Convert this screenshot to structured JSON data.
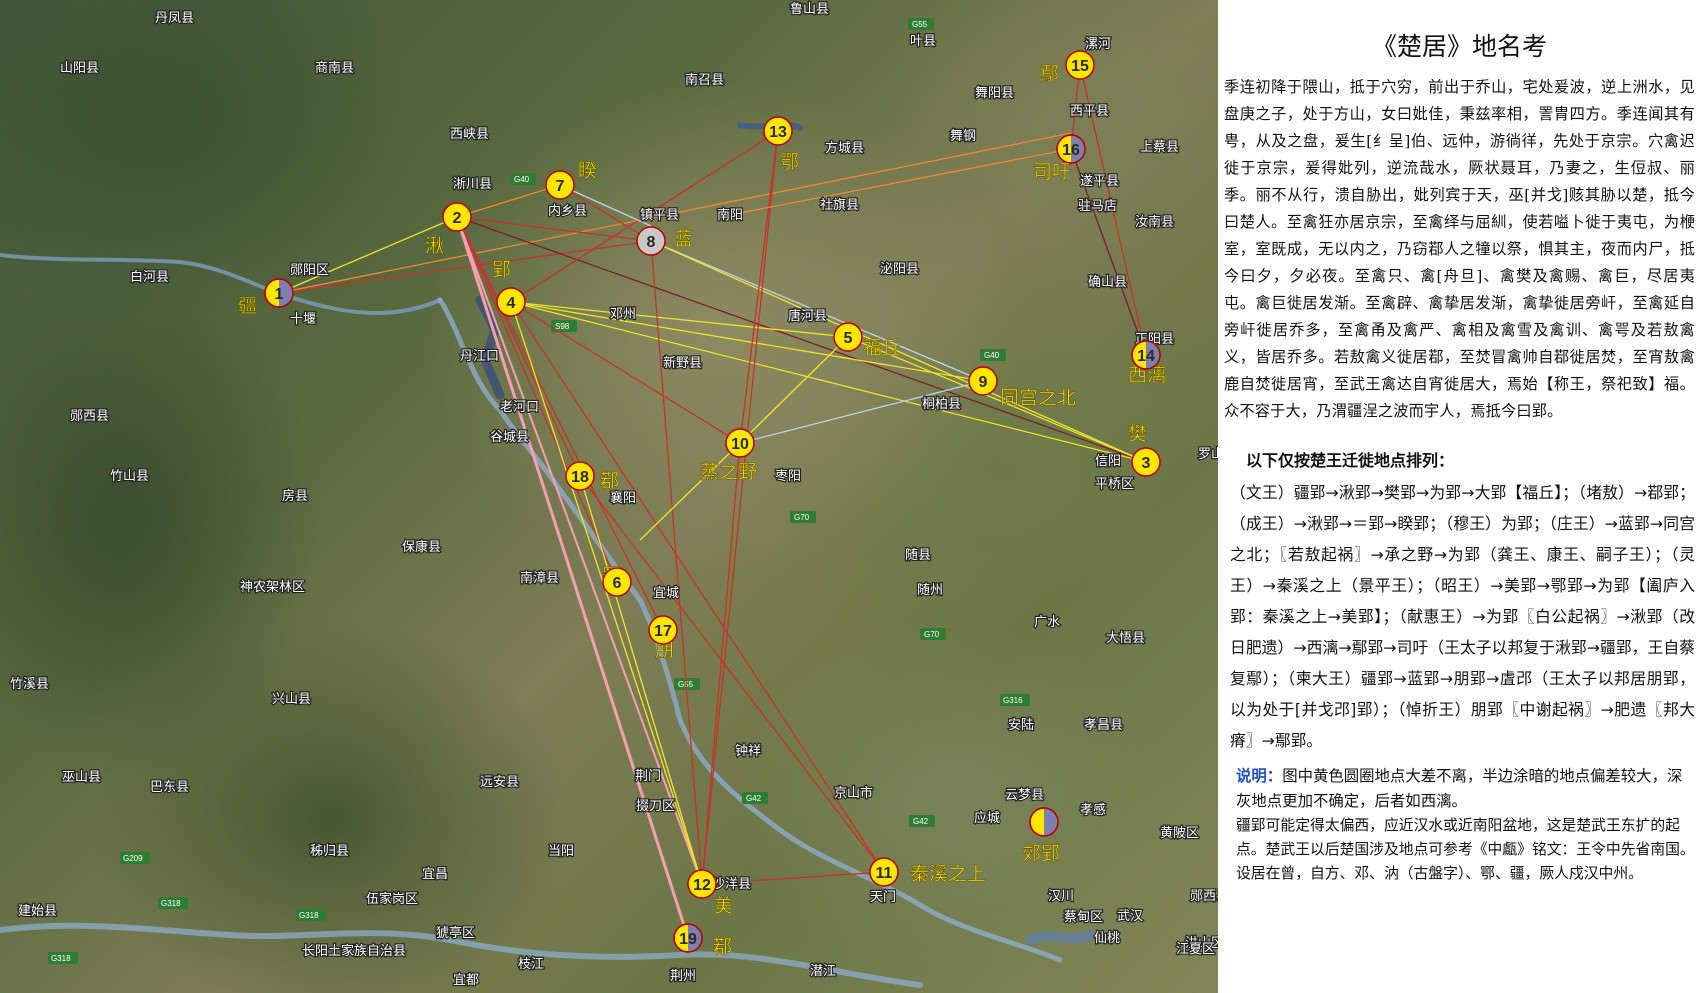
{
  "colors": {
    "marker_fill": "#ffe600",
    "marker_stroke": "#b80000",
    "site_label": "#ffe800",
    "half_dark": "#7d7fae",
    "line_red": "#c8322a",
    "line_yellow": "#f0e52a",
    "line_pink": "#f4a0b0",
    "line_orange": "#f08a30",
    "line_lightblue": "#b9d6ea",
    "line_darkred": "#7a1f2a"
  },
  "map": {
    "markers": [
      {
        "n": "1",
        "state": "half"
      },
      {
        "n": "2",
        "state": "full"
      },
      {
        "n": "3",
        "state": "full"
      },
      {
        "n": "4",
        "state": "full"
      },
      {
        "n": "5",
        "state": "full"
      },
      {
        "n": "6",
        "state": "full"
      },
      {
        "n": "7",
        "state": "full"
      },
      {
        "n": "8",
        "state": "gray"
      },
      {
        "n": "9",
        "state": "full"
      },
      {
        "n": "10",
        "state": "full"
      },
      {
        "n": "11",
        "state": "full"
      },
      {
        "n": "12",
        "state": "full"
      },
      {
        "n": "13",
        "state": "full"
      },
      {
        "n": "14",
        "state": "half"
      },
      {
        "n": "15",
        "state": "full"
      },
      {
        "n": "16",
        "state": "half"
      },
      {
        "n": "17",
        "state": "full"
      },
      {
        "n": "18",
        "state": "full"
      },
      {
        "n": "19",
        "state": "half"
      },
      {
        "n": "",
        "state": "half"
      }
    ],
    "site_labels": [
      "疆",
      "湫",
      "郢",
      "樊",
      "福丘",
      "同宫之北",
      "蒸之野",
      "鄀",
      "郢",
      "朋",
      "美",
      "鄀",
      "秦溪之上",
      "鄢",
      "司吁",
      "西漓",
      "睽",
      "蓝",
      "鄂",
      "郊郢"
    ],
    "cities": [
      "丹凤县",
      "商南县",
      "山阳县",
      "西峡县",
      "淅川县",
      "内乡县",
      "镇平县",
      "南阳",
      "南召县",
      "方城县",
      "舞钢",
      "舞阳县",
      "漯河",
      "叶县",
      "鲁山县",
      "西平县",
      "上蔡县",
      "遂平县",
      "驻马店",
      "汝南县",
      "确山县",
      "正阳县",
      "泌阳县",
      "唐河县",
      "社旗县",
      "新野县",
      "桐柏县",
      "信阳",
      "平桥区",
      "罗山",
      "邓州",
      "丹江口",
      "老河口",
      "谷城县",
      "襄阳",
      "枣阳",
      "南漳县",
      "宜城",
      "随县",
      "随州",
      "广水",
      "大悟县",
      "安陆",
      "孝昌县",
      "孝感",
      "云梦县",
      "应城",
      "汉川",
      "京山市",
      "钟祥",
      "荆门",
      "掇刀区",
      "沙洋县",
      "天门",
      "潜江",
      "荆州",
      "枝江",
      "宜都",
      "当阳",
      "远安县",
      "保康县",
      "房县",
      "竹山县",
      "竹溪县",
      "郧西县",
      "白河县",
      "郧阳区",
      "十堰",
      "神农架林区",
      "兴山县",
      "巴东县",
      "巫山县",
      "秭归县",
      "宜昌",
      "建始县",
      "伍家岗区",
      "长阳土家族自治县",
      "猇亭区",
      "蔡甸区",
      "武汉",
      "黄陂区",
      "洪山区",
      "江夏区",
      "仙桃",
      "郧西县"
    ]
  },
  "panel": {
    "title": "《楚居》地名考",
    "body": "季连初降于隈山，抵于穴穷，前出于乔山，宅处爰波，逆上洲水，见盘庚之子，处于方山，女曰妣佳，秉兹率相，詈胄四方。季连闻其有甹，从及之盘，爰生[纟呈]伯、远仲，游徜徉，先处于京宗。穴禽迟徙于京宗，爰得妣列，逆流哉水，厥状聂耳，乃妻之，生侸叔、丽季。丽不从行，溃自胁出，妣列宾于天，巫[并戈]赅其胁以楚，抵今曰楚人。至禽狂亦居京宗，至禽绎与屈紃，使若嗌卜徙于夷屯，为楩室，室既成，无以内之，乃窃鄀人之犝以祭，惧其主，夜而内尸，抵今曰夕，夕必夜。至禽只、禽[舟旦]、禽樊及禽赐、禽巨，尽居夷屯。禽巨徙居发渐。至禽辟、禽挚居发渐，禽挚徙居旁屽，至禽延自旁屽徙居乔多，至禽甬及禽严、禽相及禽雪及禽训、禽咢及若敖禽义，皆居乔多。若敖禽义徙居鄀，至焚冒禽帅自鄀徙居焚，至宵敖禽鹿自焚徙居宵，至武王禽达自宵徙居大，焉始【称王，祭祀致】福。众不容于大，乃渭疆浧之波而宇人，焉抵今曰郢。",
    "subhead": "以下仅按楚王迁徙地点排列：",
    "sequence": "（文王）疆郢→湫郢→樊郢→为郢→大郢【福丘】；（堵敖）→鄀郢；（成王）→湫郢→＝郢→睽郢；（穆王）为郢；（庄王）→蓝郢→同宫之北；〖若敖起祸〗→承之野→为郢（龚王、康王、嗣子王）；（灵王）→秦溪之上（景平王）；（昭王）→美郢→鄂郢→为郢【阖庐入郢：秦溪之上→美郢】；（献惠王）→为郢〖白公起祸〗→湫郢（改日肥遗）→西漓→鄢郢→司吁（王太子以邦复于湫郢→疆郢，王自蔡复鄢）；（柬大王）疆郢→蓝郢→朋郢→虘邔（王太子以邦居朋郢，以为处于[并戈邔]郢）；（悼折王）朋郢〖中谢起祸〗→肥遗〖邦大瘠〗→鄢郢。",
    "note_label": "说明：",
    "note": "图中黄色圆圈地点大差不离，半边涂暗的地点偏差较大，深灰地点更加不确定，后者如西漓。",
    "note2": "疆郢可能定得太偏西，应近汉水或近南阳盆地，这是楚武王东扩的起点。楚武王以后楚国涉及地点可参考《中甗》铭文：王令中先省南国。设居在曾，自方、邓、汭（古盤字）、鄂、疆，厥人戍汉中州。"
  }
}
